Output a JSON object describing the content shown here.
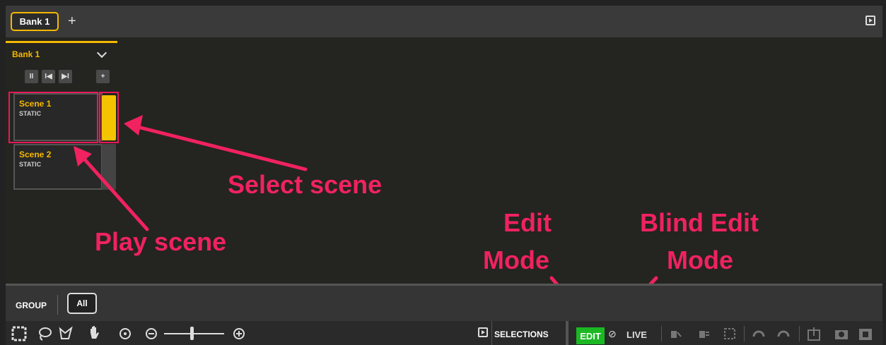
{
  "topbar": {
    "tab_label": "Bank 1",
    "add_tab": "+"
  },
  "bank": {
    "title": "Bank 1",
    "controls": [
      "II",
      "I◀",
      "▶I"
    ],
    "add": "+",
    "scenes": [
      {
        "name": "Scene 1",
        "type": "STATIC",
        "playing": true
      },
      {
        "name": "Scene 2",
        "type": "STATIC",
        "playing": false
      }
    ]
  },
  "annotations": {
    "select_scene": "Select scene",
    "play_scene": "Play scene",
    "edit_mode": "Edit",
    "edit_mode_2": "Mode",
    "blind_edit": "Blind Edit",
    "blind_edit_2": "Mode"
  },
  "group": {
    "label": "GROUP",
    "all": "All"
  },
  "toolbar": {
    "selections_label": "SELECTIONS",
    "edit_label": "EDIT",
    "live_label": "LIVE",
    "blind_icon": "⊘"
  },
  "colors": {
    "accent": "#f5b800",
    "annotation": "#f0225f",
    "edit_green": "#1bb823"
  }
}
